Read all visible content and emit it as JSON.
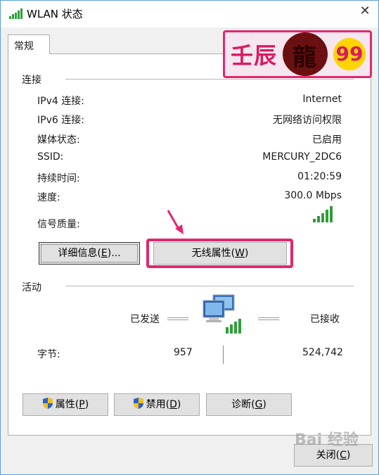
{
  "window": {
    "title": "WLAN 状态",
    "close_glyph": "✕",
    "icon": "wifi-signal-icon"
  },
  "tabs": [
    {
      "label": "常规",
      "selected": true
    }
  ],
  "logo": {
    "left_text": "壬辰",
    "center_text": "龍",
    "right_text": "99"
  },
  "connection": {
    "section_label": "连接",
    "rows": [
      {
        "label": "IPv4 连接:",
        "value": "Internet"
      },
      {
        "label": "IPv6 连接:",
        "value": "无网络访问权限"
      },
      {
        "label": "媒体状态:",
        "value": "已启用"
      },
      {
        "label": "SSID:",
        "value": "MERCURY_2DC6"
      },
      {
        "label": "持续时间:",
        "value": "01:20:59"
      },
      {
        "label": "速度:",
        "value": "300.0 Mbps"
      }
    ],
    "signal_label": "信号质量:",
    "signal_bars": 5,
    "details_button": "详细信息(E)...",
    "details_button_pre": "详细信息(",
    "details_button_key": "E",
    "details_button_post": ")...",
    "wireless_button_pre": "无线属性(",
    "wireless_button_key": "W",
    "wireless_button_post": ")"
  },
  "activity": {
    "section_label": "活动",
    "sent_label": "已发送",
    "received_label": "已接收",
    "bytes_label": "字节:",
    "bytes_sent": "957",
    "bytes_received": "524,742"
  },
  "buttons": {
    "properties_pre": "属性(",
    "properties_key": "P",
    "properties_post": ")",
    "disable_pre": "禁用(",
    "disable_key": "D",
    "disable_post": ")",
    "diagnose_pre": "诊断(",
    "diagnose_key": "G",
    "diagnose_post": ")",
    "close_pre": "关闭(",
    "close_key": "C",
    "close_post": ")"
  },
  "watermark": "Bai 经验",
  "colors": {
    "highlight": "#e0286e",
    "signal_green": "#2e9e3a",
    "window_border": "#5a9fd4"
  }
}
